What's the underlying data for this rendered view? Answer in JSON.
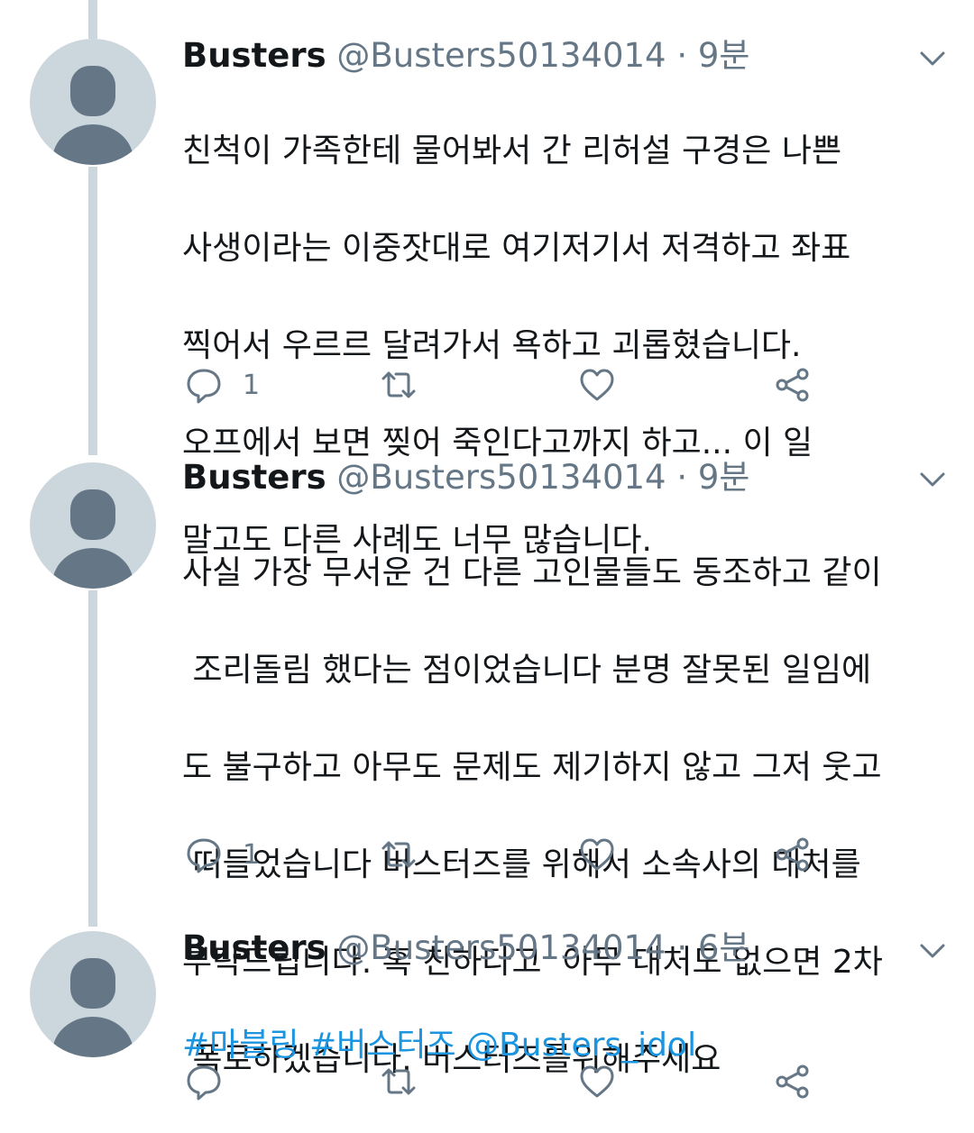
{
  "tweets": [
    {
      "name": "Busters",
      "handle": "@Busters50134014",
      "sep": " · ",
      "time": "9분",
      "lines": [
        "친척이 가족한테 물어봐서 간 리허설 구경은 나쁜",
        "사생이라는 이중잣대로 여기저기서 저격하고 좌표",
        "찍어서 우르르 달려가서 욕하고 괴롭혔습니다.",
        "오프에서 보면 찢어 죽인다고까지 하고... 이 일",
        "말고도 다른 사례도 너무 많습니다."
      ],
      "reply_count": "1"
    },
    {
      "name": "Busters",
      "handle": "@Busters50134014",
      "sep": " · ",
      "time": "9분",
      "lines": [
        "사실 가장 무서운 건 다른 고인물들도 동조하고 같이",
        " 조리돌림 했다는 점이었습니다 분명 잘못된 일임에",
        "도 불구하고 아무도 문제도 제기하지 않고 그저 웃고",
        " 떠들었습니다 버스터즈를 위해서 소속사의 대처를",
        "부탁드립니다. 혹 친하다고  아무 대처도 없으면 2차",
        " 폭로하겠습니다. 버스터즈를위해주세요"
      ],
      "reply_count": "1"
    },
    {
      "name": "Busters",
      "handle": "@Busters50134014",
      "sep": " · ",
      "time": "6분",
      "tags": [
        "#마블링",
        "#버스터즈",
        "@Busters_idol"
      ],
      "reply_count": ""
    }
  ],
  "colors": {
    "text": "#14171a",
    "secondary": "#657786",
    "link": "#1b95e0",
    "avatar_bg": "#ccd6dd",
    "thread_line": "#ccd6dd"
  },
  "icons": {
    "reply": "reply-icon",
    "retweet": "retweet-icon",
    "like": "like-icon",
    "share": "share-icon",
    "menu": "chevron-down-icon"
  }
}
